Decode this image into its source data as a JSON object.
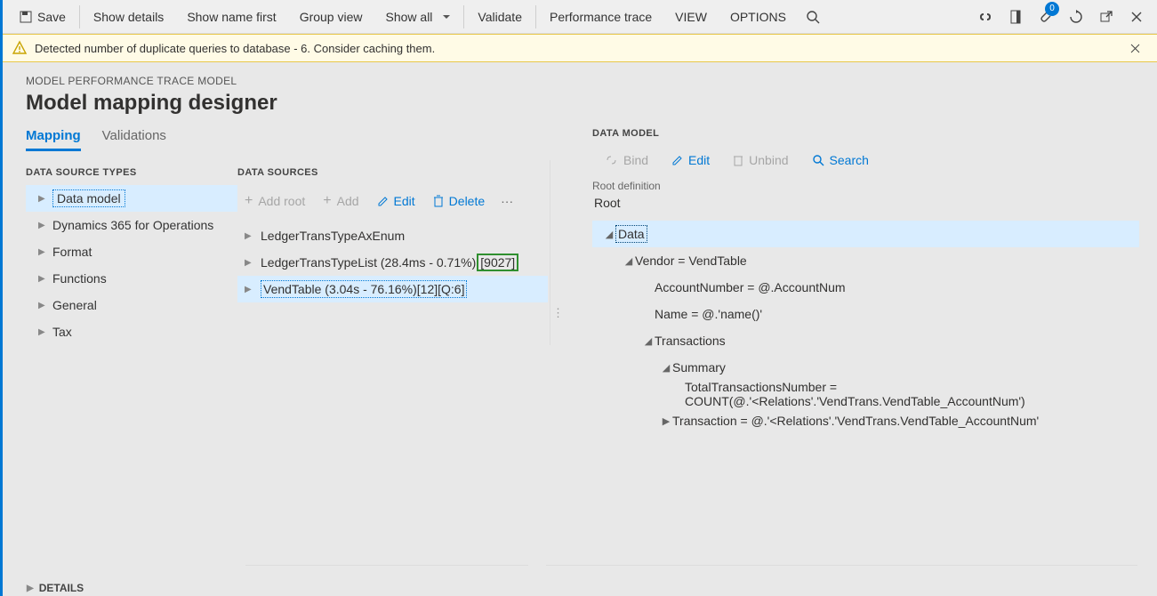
{
  "commandbar": {
    "save": "Save",
    "show_details": "Show details",
    "show_name_first": "Show name first",
    "group_view": "Group view",
    "show_all": "Show all",
    "validate": "Validate",
    "perf_trace": "Performance trace",
    "view": "VIEW",
    "options": "OPTIONS",
    "notif_count": "0"
  },
  "warning": "Detected number of duplicate queries to database - 6. Consider caching them.",
  "breadcrumb": "MODEL PERFORMANCE TRACE MODEL",
  "page_title": "Model mapping designer",
  "tabs": {
    "mapping": "Mapping",
    "validations": "Validations"
  },
  "types": {
    "heading": "DATA SOURCE TYPES",
    "items": [
      "Data model",
      "Dynamics 365 for Operations",
      "Format",
      "Functions",
      "General",
      "Tax"
    ]
  },
  "sources": {
    "heading": "DATA SOURCES",
    "toolbar": {
      "add_root": "Add root",
      "add": "Add",
      "edit": "Edit",
      "delete": "Delete"
    },
    "items": [
      {
        "label": "LedgerTransTypeAxEnum"
      },
      {
        "label": "LedgerTransTypeList (28.4ms - 0.71%)",
        "highlight": "[9027]"
      },
      {
        "label": "VendTable (3.04s - 76.16%)[12][Q:6]"
      }
    ]
  },
  "datamodel": {
    "heading": "DATA MODEL",
    "toolbar": {
      "bind": "Bind",
      "edit": "Edit",
      "unbind": "Unbind",
      "search": "Search"
    },
    "root_label": "Root definition",
    "root_value": "Root",
    "tree": [
      {
        "lvl": 0,
        "exp": true,
        "label": "Data",
        "sel": true
      },
      {
        "lvl": 1,
        "exp": true,
        "label": "Vendor = VendTable"
      },
      {
        "lvl": 2,
        "exp": null,
        "label": "AccountNumber = @.AccountNum"
      },
      {
        "lvl": 2,
        "exp": null,
        "label": "Name = @.'name()'"
      },
      {
        "lvl": 2,
        "exp": true,
        "label": "Transactions"
      },
      {
        "lvl": 3,
        "exp": true,
        "label": "Summary"
      },
      {
        "lvl": 3,
        "indent": "extra",
        "label": "TotalTransactionsNumber = COUNT(@.'<Relations'.'VendTrans.VendTable_AccountNum')"
      },
      {
        "lvl": 3,
        "exp": false,
        "label": "Transaction = @.'<Relations'.'VendTrans.VendTable_AccountNum'"
      }
    ]
  },
  "details": "DETAILS"
}
